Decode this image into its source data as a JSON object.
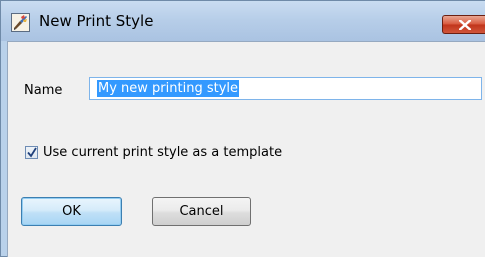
{
  "window": {
    "title": "New Print Style",
    "app_icon": "print-style-brush-icon",
    "close_icon": "close-x-icon"
  },
  "form": {
    "name_label": "Name",
    "name_value": "My new printing style",
    "checkbox_label": "Use current print style as a template",
    "checkbox_checked": true
  },
  "buttons": {
    "ok_label": "OK",
    "cancel_label": "Cancel"
  },
  "colors": {
    "title_bar": "#b9d1ea",
    "close_button": "#c7462a",
    "selection": "#3399ff",
    "ok_border": "#3c7fb1"
  }
}
